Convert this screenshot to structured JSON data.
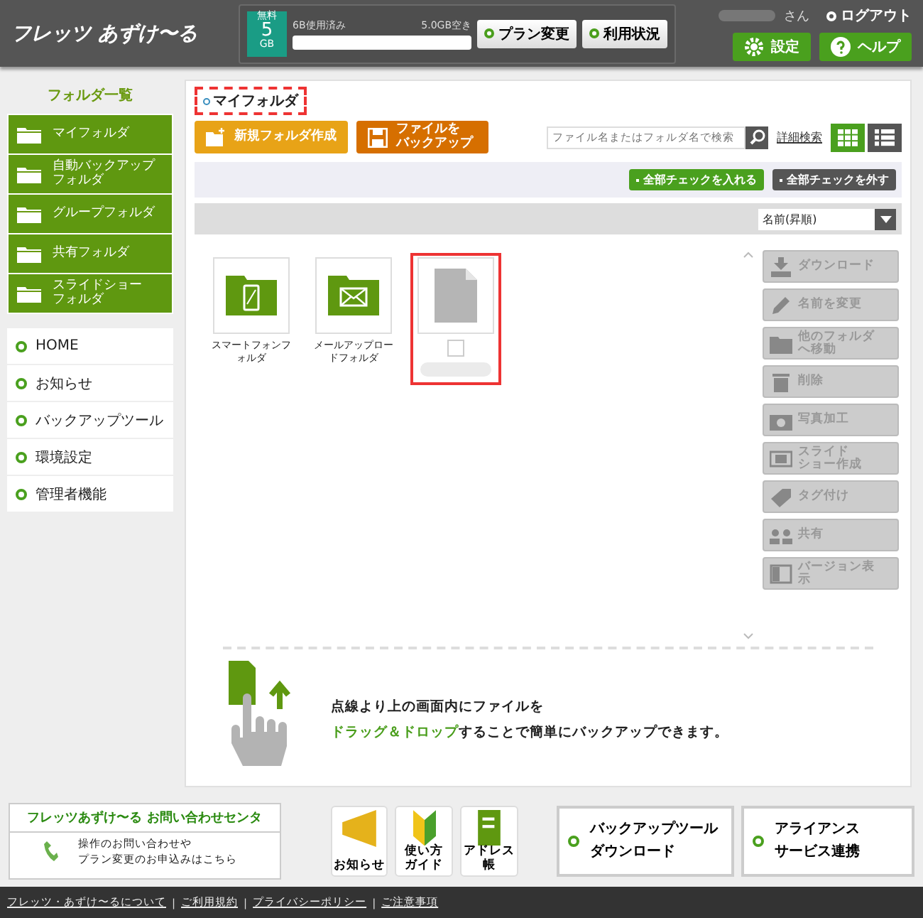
{
  "header": {
    "logo": "フレッツ あずけ〜る",
    "plan": {
      "badge_top": "無料",
      "badge_num": "5",
      "badge_unit": "GB",
      "used": "6B使用済み",
      "free": "5.0GB空き"
    },
    "plan_buttons": [
      "プラン変更",
      "利用状況"
    ],
    "user_suffix": "さん",
    "logout": "ログアウト",
    "settings": "設定",
    "help": "ヘルプ"
  },
  "sidebar": {
    "title": "フォルダ一覧",
    "folders": [
      "マイフォルダ",
      "自動バックアップフォルダ",
      "グループフォルダ",
      "共有フォルダ",
      "スライドショーフォルダ"
    ],
    "nav": [
      "HOME",
      "お知らせ",
      "バックアップツール",
      "環境設定",
      "管理者機能"
    ]
  },
  "content": {
    "breadcrumb": "マイフォルダ",
    "new_folder": "新規フォルダ作成",
    "backup_file": "ファイルをバックアップ",
    "search": {
      "placeholder": "ファイル名またはフォルダ名で検索"
    },
    "advanced_search": "詳細検索",
    "views": [
      {
        "kind": "grid",
        "selected": true
      },
      {
        "kind": "list",
        "selected": false
      }
    ],
    "check_all": "全部チェックを入れる",
    "uncheck_all": "全部チェックを外す",
    "sort": "名前(昇順)",
    "items": [
      {
        "kind": "phone-folder",
        "name": "スマートフォンフォルダ",
        "selected": false
      },
      {
        "kind": "mail-folder",
        "name": "メールアップロードフォルダ",
        "selected": false
      },
      {
        "kind": "file",
        "selected": true,
        "checked": false
      }
    ],
    "actions": [
      {
        "kind": "download",
        "label": "ダウンロード",
        "disabled": true
      },
      {
        "kind": "rename",
        "label": "名前を変更",
        "disabled": true
      },
      {
        "kind": "move",
        "label": "他のフォルダへ移動",
        "disabled": true
      },
      {
        "kind": "delete",
        "label": "削除",
        "disabled": true
      },
      {
        "kind": "photo",
        "label": "写真加工",
        "disabled": true
      },
      {
        "kind": "slideshow",
        "label": "スライドショー作成",
        "disabled": true
      },
      {
        "kind": "tag",
        "label": "タグ付け",
        "disabled": true
      },
      {
        "kind": "share",
        "label": "共有",
        "disabled": true
      },
      {
        "kind": "version",
        "label": "バージョン表示",
        "disabled": true
      }
    ],
    "drop_hint": [
      "点線より上の画面内にファイルを",
      "**ドラッグ＆ドロップ**することで簡単にバックアップできます。"
    ]
  },
  "footer": {
    "contact_title": "フレッツあずけ〜る お問い合わせセンタ",
    "contact_text": [
      "操作のお問い合わせや",
      "プラン変更のお申込みはこちら"
    ],
    "tiles": [
      {
        "kind": "megaphone",
        "label": "お知らせ"
      },
      {
        "kind": "leaf",
        "label": "使い方ガイド"
      },
      {
        "kind": "notebook",
        "label": "アドレス帳"
      }
    ],
    "big_buttons": [
      "バックアップツールダウンロード",
      "アライアンスサービス連携"
    ],
    "links": [
      "フレッツ・あずけ〜るについて",
      "ご利用規約",
      "プライバシーポリシー",
      "ご注意事項"
    ],
    "separator": "|"
  }
}
